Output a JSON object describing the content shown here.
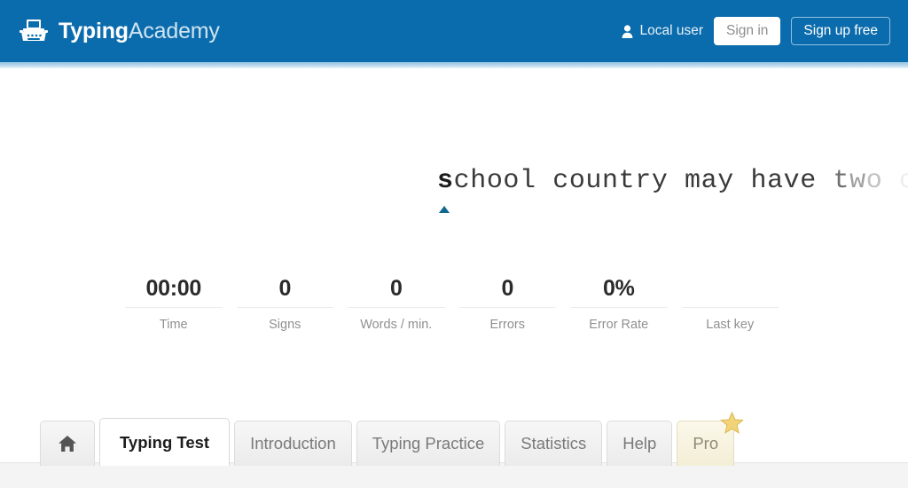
{
  "header": {
    "logo_icon": "typewriter-icon",
    "brand_strong": "Typing",
    "brand_light": "Academy",
    "user_icon": "user-icon",
    "user_label": "Local user",
    "sign_in_label": "Sign in",
    "sign_up_label": "Sign up free",
    "background_color": "#0b6cad"
  },
  "typing": {
    "segments": [
      {
        "text": "s",
        "state": "current"
      },
      {
        "text": "chool country may have ",
        "state": "typed"
      },
      {
        "text": "t",
        "state": "fade1"
      },
      {
        "text": "w",
        "state": "fade2"
      },
      {
        "text": "o",
        "state": "fade3"
      },
      {
        "text": " ",
        "state": "fade4"
      },
      {
        "text": "c",
        "state": "fade5"
      }
    ],
    "full_text": "school country may have two c",
    "cursor_icon": "caret-triangle-icon",
    "cursor_color": "#11688f"
  },
  "stats": [
    {
      "value": "00:00",
      "label": "Time"
    },
    {
      "value": "0",
      "label": "Signs"
    },
    {
      "value": "0",
      "label": "Words / min."
    },
    {
      "value": "0",
      "label": "Errors"
    },
    {
      "value": "0%",
      "label": "Error Rate"
    },
    {
      "value": "",
      "label": "Last key"
    }
  ],
  "tabs": [
    {
      "label": "",
      "icon": "home-icon",
      "state": "normal"
    },
    {
      "label": "Typing Test",
      "icon": "",
      "state": "active"
    },
    {
      "label": "Introduction",
      "icon": "",
      "state": "normal"
    },
    {
      "label": "Typing Practice",
      "icon": "",
      "state": "normal"
    },
    {
      "label": "Statistics",
      "icon": "",
      "state": "normal"
    },
    {
      "label": "Help",
      "icon": "",
      "state": "normal"
    },
    {
      "label": "Pro",
      "icon": "star-badge-icon",
      "state": "pro"
    }
  ]
}
